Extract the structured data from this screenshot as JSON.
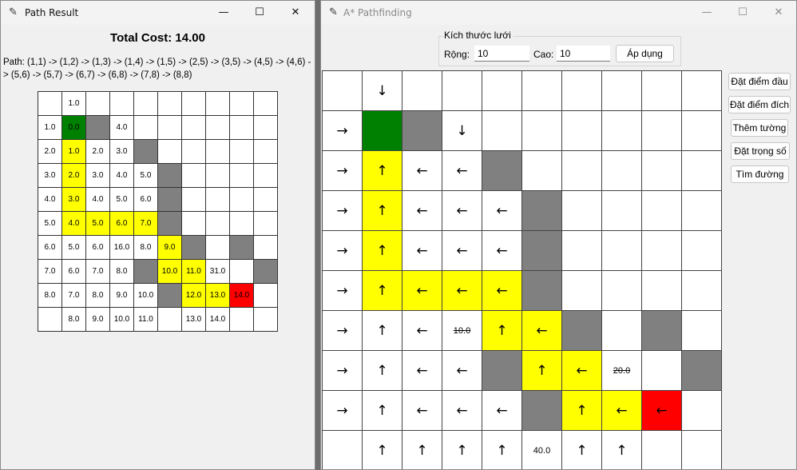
{
  "result_window": {
    "title": "Path Result",
    "total_cost": "Total Cost: 14.00",
    "path_text": "Path: (1,1) -> (1,2) -> (1,3) -> (1,4) -> (1,5) -> (2,5) -> (3,5) -> (4,5) -> (4,6) -> (5,6) -> (5,7) -> (6,7) -> (6,8) -> (7,8) -> (8,8)",
    "grid": [
      [
        "",
        "1.0",
        "",
        "",
        "",
        "",
        "",
        "",
        "",
        ""
      ],
      [
        "1.0",
        "0.0",
        "",
        "4.0",
        "",
        "",
        "",
        "",
        "",
        ""
      ],
      [
        "2.0",
        "1.0",
        "2.0",
        "3.0",
        "",
        "",
        "",
        "",
        "",
        ""
      ],
      [
        "3.0",
        "2.0",
        "3.0",
        "4.0",
        "5.0",
        "",
        "",
        "",
        "",
        ""
      ],
      [
        "4.0",
        "3.0",
        "4.0",
        "5.0",
        "6.0",
        "",
        "",
        "",
        "",
        ""
      ],
      [
        "5.0",
        "4.0",
        "5.0",
        "6.0",
        "7.0",
        "",
        "",
        "",
        "",
        ""
      ],
      [
        "6.0",
        "5.0",
        "6.0",
        "16.0",
        "8.0",
        "9.0",
        "",
        "",
        "",
        ""
      ],
      [
        "7.0",
        "6.0",
        "7.0",
        "8.0",
        "",
        "10.0",
        "11.0",
        "31.0",
        "",
        ""
      ],
      [
        "8.0",
        "7.0",
        "8.0",
        "9.0",
        "10.0",
        "",
        "12.0",
        "13.0",
        "14.0",
        ""
      ],
      [
        "",
        "8.0",
        "9.0",
        "10.0",
        "11.0",
        "",
        "13.0",
        "14.0",
        "",
        ""
      ]
    ]
  },
  "main_window": {
    "title": "A* Pathfinding",
    "frame_label": "Kích thước lưới",
    "width_label": "Rộng:",
    "width_value": "10",
    "height_label": "Cao:",
    "height_value": "10",
    "apply_label": "Áp dụng",
    "side_buttons": [
      "Đặt điểm đầu",
      "Đặt điểm đích",
      "Thêm tường",
      "Đặt trọng số",
      "Tìm đường"
    ],
    "grid": [
      [
        "",
        "↓",
        "",
        "",
        "",
        "",
        "",
        "",
        "",
        ""
      ],
      [
        "→",
        "",
        "",
        "↓",
        "",
        "",
        "",
        "",
        "",
        ""
      ],
      [
        "→",
        "↑",
        "←",
        "←",
        "",
        "",
        "",
        "",
        "",
        ""
      ],
      [
        "→",
        "↑",
        "←",
        "←",
        "←",
        "",
        "",
        "",
        "",
        ""
      ],
      [
        "→",
        "↑",
        "←",
        "←",
        "←",
        "",
        "",
        "",
        "",
        ""
      ],
      [
        "→",
        "↑",
        "←",
        "←",
        "←",
        "",
        "",
        "",
        "",
        ""
      ],
      [
        "→",
        "↑",
        "←",
        "10.0",
        "↑",
        "←",
        "",
        "",
        "",
        ""
      ],
      [
        "→",
        "↑",
        "←",
        "←",
        "",
        "↑",
        "←",
        "20.0",
        "",
        ""
      ],
      [
        "→",
        "↑",
        "←",
        "←",
        "←",
        "",
        "↑",
        "←",
        "←",
        ""
      ],
      [
        "",
        "↑",
        "↑",
        "↑",
        "↑",
        "40.0",
        "↑",
        "↑",
        "",
        ""
      ]
    ]
  },
  "colors": {
    "wall": "#808080",
    "path": "#ffff00",
    "start": "#008000",
    "end": "#ff0000"
  }
}
